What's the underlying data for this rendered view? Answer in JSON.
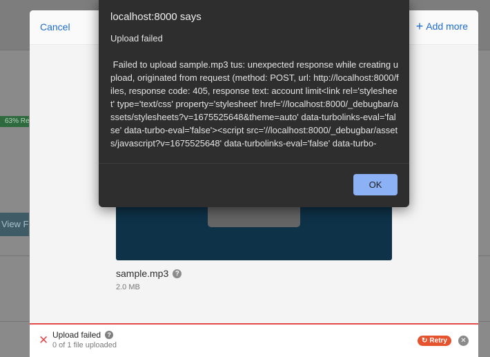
{
  "background": {
    "progress_badge": "63% Re",
    "view_button": "View F"
  },
  "modal": {
    "cancel_label": "Cancel",
    "add_more_label": "Add more",
    "file": {
      "name": "sample.mp3",
      "size": "2.0 MB"
    },
    "status": {
      "title": "Upload failed",
      "subtitle": "0 of 1 file uploaded",
      "retry_label": "Retry"
    }
  },
  "alert": {
    "origin": "localhost:8000 says",
    "title": "Upload failed",
    "message": " Failed to upload sample.mp3 tus: unexpected response while creating upload, originated from request (method: POST, url: http://localhost:8000/files, response code: 405, response text: account limit<link rel='stylesheet' type='text/css' property='stylesheet' href='//localhost:8000/_debugbar/assets/stylesheets?v=1675525648&theme=auto' data-turbolinks-eval='false' data-turbo-eval='false'><script src='//localhost:8000/_debugbar/assets/javascript?v=1675525648' data-turbolinks-eval='false' data-turbo-",
    "ok_label": "OK"
  },
  "colors": {
    "accent": "#1b6bd6",
    "error": "#e24a4a",
    "retry": "#e5532f",
    "ok_button": "#8db1f5"
  }
}
